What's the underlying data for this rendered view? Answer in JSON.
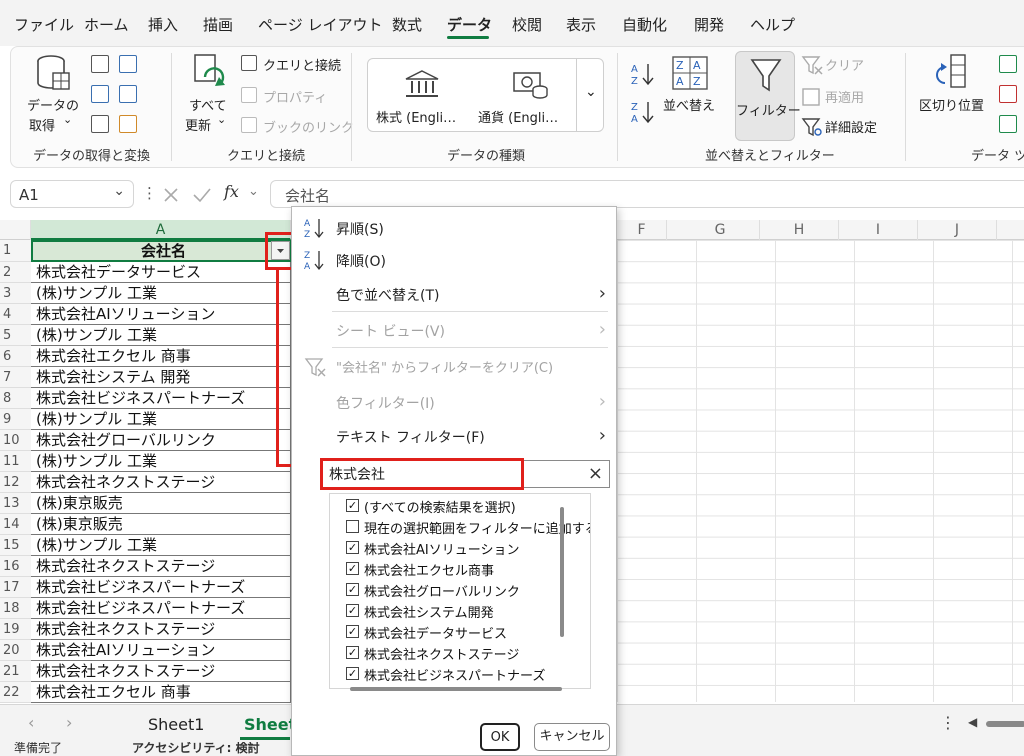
{
  "menu_tabs": [
    {
      "label": "ファイル"
    },
    {
      "label": "ホーム"
    },
    {
      "label": "挿入"
    },
    {
      "label": "描画"
    },
    {
      "label": "ページ レイアウト"
    },
    {
      "label": "数式"
    },
    {
      "label": "データ"
    },
    {
      "label": "校閲"
    },
    {
      "label": "表示"
    },
    {
      "label": "自動化"
    },
    {
      "label": "開発"
    },
    {
      "label": "ヘルプ"
    }
  ],
  "ribbon": {
    "get_data_line1": "データの",
    "get_data_line2": "取得",
    "refresh_line1": "すべて",
    "refresh_line2": "更新",
    "query_connections": "クエリと接続",
    "properties": "プロパティ",
    "workbook_links": "ブックのリンク",
    "stocks": "株式 (Engli…",
    "currencies": "通貨 (Engli…",
    "sort": "並べ替え",
    "filter": "フィルター",
    "clear": "クリア",
    "reapply": "再適用",
    "advanced": "詳細設定",
    "text_to_columns": "区切り位置",
    "groups": {
      "get_transform": "データの取得と変換",
      "queries": "クエリと接続",
      "data_types": "データの種類",
      "sort_filter": "並べ替えとフィルター",
      "data_tools": "データ ツー"
    }
  },
  "formula_bar": {
    "name_box": "A1",
    "fx": "fx",
    "content": "会社名"
  },
  "columns": [
    "A",
    "F",
    "G",
    "H",
    "I",
    "J"
  ],
  "rows": [
    {
      "num": "1",
      "value": "会社名"
    },
    {
      "num": "2",
      "value": "株式会社データサービス"
    },
    {
      "num": "3",
      "value": "(株)サンプル 工業"
    },
    {
      "num": "4",
      "value": "株式会社AIソリューション"
    },
    {
      "num": "5",
      "value": "(株)サンプル 工業"
    },
    {
      "num": "6",
      "value": "株式会社エクセル 商事"
    },
    {
      "num": "7",
      "value": "株式会社システム 開発"
    },
    {
      "num": "8",
      "value": "株式会社ビジネスパートナーズ"
    },
    {
      "num": "9",
      "value": "(株)サンプル 工業"
    },
    {
      "num": "10",
      "value": "株式会社グローバルリンク"
    },
    {
      "num": "11",
      "value": "(株)サンプル 工業"
    },
    {
      "num": "12",
      "value": "株式会社ネクストステージ"
    },
    {
      "num": "13",
      "value": "(株)東京販売"
    },
    {
      "num": "14",
      "value": "(株)東京販売"
    },
    {
      "num": "15",
      "value": "(株)サンプル 工業"
    },
    {
      "num": "16",
      "value": "株式会社ネクストステージ"
    },
    {
      "num": "17",
      "value": "株式会社ビジネスパートナーズ"
    },
    {
      "num": "18",
      "value": "株式会社ビジネスパートナーズ"
    },
    {
      "num": "19",
      "value": "株式会社ネクストステージ"
    },
    {
      "num": "20",
      "value": "株式会社AIソリューション"
    },
    {
      "num": "21",
      "value": "株式会社ネクストステージ"
    },
    {
      "num": "22",
      "value": "株式会社エクセル 商事"
    }
  ],
  "filter_menu": {
    "sort_asc": "昇順(S)",
    "sort_desc": "降順(O)",
    "sort_by_color": "色で並べ替え(T)",
    "sheet_view": "シート ビュー(V)",
    "clear_filter": "\"会社名\" からフィルターをクリア(C)",
    "color_filter": "色フィルター(I)",
    "text_filter": "テキスト フィルター(F)",
    "search_value": "株式会社",
    "list": [
      {
        "label": "(すべての検索結果を選択)",
        "checked": true
      },
      {
        "label": "現在の選択範囲をフィルターに追加する",
        "checked": false
      },
      {
        "label": "株式会社AIソリューション",
        "checked": true
      },
      {
        "label": "株式会社エクセル商事",
        "checked": true
      },
      {
        "label": "株式会社グローバルリンク",
        "checked": true
      },
      {
        "label": "株式会社システム開発",
        "checked": true
      },
      {
        "label": "株式会社データサービス",
        "checked": true
      },
      {
        "label": "株式会社ネクストステージ",
        "checked": true
      },
      {
        "label": "株式会社ビジネスパートナーズ",
        "checked": true
      }
    ],
    "ok": "OK",
    "cancel": "キャンセル"
  },
  "sheets": [
    "Sheet1",
    "Sheet"
  ],
  "status": {
    "ready": "準備完了",
    "accessibility": "アクセシビリティ: 検討"
  },
  "colors": {
    "accent": "#107c41",
    "highlight_box": "#e0201b"
  }
}
